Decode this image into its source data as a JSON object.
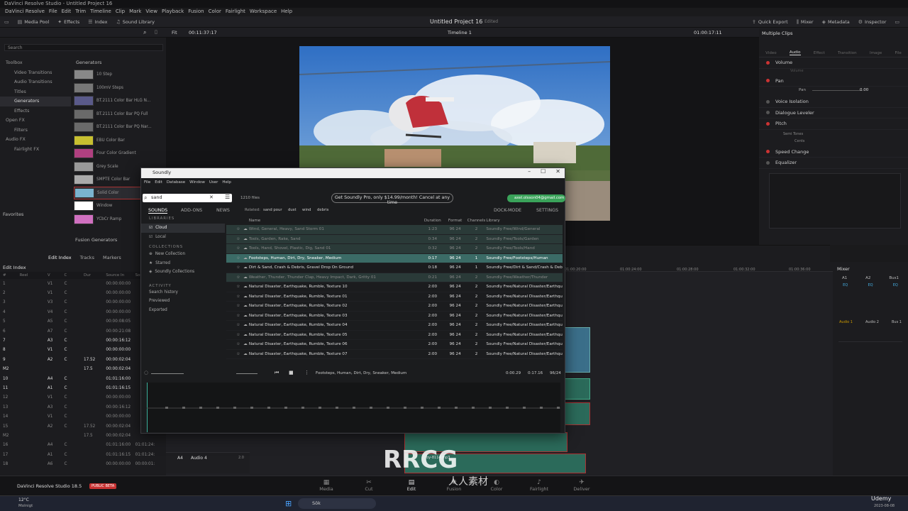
{
  "window_title": "DaVinci Resolve Studio - Untitled Project 16",
  "menu": [
    "DaVinci Resolve",
    "File",
    "Edit",
    "Trim",
    "Timeline",
    "Clip",
    "Mark",
    "View",
    "Playback",
    "Fusion",
    "Color",
    "Fairlight",
    "Workspace",
    "Help"
  ],
  "toolbar": {
    "left": [
      {
        "icon": "media-pool-icon",
        "label": "Media Pool"
      },
      {
        "icon": "effects-icon",
        "label": "Effects"
      },
      {
        "icon": "index-icon",
        "label": "Index"
      },
      {
        "icon": "sound-library-icon",
        "label": "Sound Library"
      }
    ],
    "project_title": "Untitled Project 16",
    "edited": "Edited",
    "right": [
      {
        "icon": "quick-export-icon",
        "label": "Quick Export"
      },
      {
        "icon": "mixer-icon",
        "label": "Mixer"
      },
      {
        "icon": "metadata-icon",
        "label": "Metadata"
      },
      {
        "icon": "inspector-icon",
        "label": "Inspector"
      }
    ]
  },
  "viewer": {
    "fit": "Fit",
    "timecode_left": "00:11:37:17",
    "timeline_name": "Timeline 1",
    "timecode_right": "01:00:17:11"
  },
  "effects": {
    "search_placeholder": "Search",
    "tree": [
      "Toolbox",
      "Video Transitions",
      "Audio Transitions",
      "Titles",
      "Generators",
      "Effects",
      "Open FX",
      "Filters",
      "Audio FX",
      "Fairlight FX"
    ],
    "favorites": "Favorites",
    "generators_header": "Generators",
    "generators": [
      {
        "label": "10 Step",
        "color": "#888"
      },
      {
        "label": "100mV Steps",
        "color": "#777"
      },
      {
        "label": "BT.2111 Color Bar HLG N...",
        "color": "#5a5a8a"
      },
      {
        "label": "BT.2111 Color Bar PQ Full",
        "color": "#6a6a6a"
      },
      {
        "label": "BT.2111 Color Bar PQ Nar...",
        "color": "#6a6a6a"
      },
      {
        "label": "EBU Color Bar",
        "color": "#c8c030"
      },
      {
        "label": "Four Color Gradient",
        "color": "#b04080"
      },
      {
        "label": "Grey Scale",
        "color": "#999"
      },
      {
        "label": "SMPTE Color Bar",
        "color": "#aaa"
      },
      {
        "label": "Solid Color",
        "color": "#7ab3cf"
      },
      {
        "label": "Window",
        "color": "#fff"
      },
      {
        "label": "YCbCr Ramp",
        "color": "#d070c0"
      }
    ],
    "fusion_generators": "Fusion Generators"
  },
  "inspector": {
    "header": "Multiple Clips",
    "tabs": [
      "Video",
      "Audio",
      "Effect",
      "Transition",
      "Image",
      "File"
    ],
    "active_tab": "Audio",
    "rows": [
      {
        "label": "Volume",
        "on": true
      },
      {
        "label": "Pan",
        "on": true
      },
      {
        "label": "Voice Isolation",
        "on": false
      },
      {
        "label": "Dialogue Leveler",
        "on": false
      },
      {
        "label": "Pitch",
        "on": true
      },
      {
        "label": "Speed Change",
        "on": true
      },
      {
        "label": "Equalizer",
        "on": false
      }
    ],
    "pan_label": "Pan",
    "pan_value": "0.00",
    "volume_sub": "Volume",
    "semitones": "Semi Tones",
    "cents": "Cents"
  },
  "edit_index": {
    "tabs": [
      "Edit Index",
      "Tracks",
      "Markers"
    ],
    "title": "Edit Index",
    "columns": [
      "#",
      "Reel",
      "V",
      "C",
      "Dur",
      "Source In",
      "Source Out"
    ],
    "rows": [
      [
        "1",
        "",
        "V1",
        "C",
        "",
        "00:00:00:00",
        ""
      ],
      [
        "2",
        "",
        "V1",
        "C",
        "",
        "00:00:00:00",
        ""
      ],
      [
        "3",
        "",
        "V3",
        "C",
        "",
        "00:00:00:00",
        ""
      ],
      [
        "4",
        "",
        "V4",
        "C",
        "",
        "00:00:00:00",
        ""
      ],
      [
        "5",
        "",
        "A5",
        "C",
        "",
        "00:00:08:05",
        ""
      ],
      [
        "6",
        "",
        "A7",
        "C",
        "",
        "00:00:21:08",
        ""
      ],
      [
        "7",
        "",
        "A3",
        "C",
        "",
        "00:00:16:12",
        ""
      ],
      [
        "8",
        "",
        "V1",
        "C",
        "",
        "00:00:00:00",
        ""
      ],
      [
        "9",
        "",
        "A2",
        "C",
        "17.52",
        "00:00:02:04",
        ""
      ],
      [
        "M2",
        "",
        "",
        "",
        "17.5",
        "00:00:02:04",
        ""
      ],
      [
        "10",
        "",
        "A4",
        "C",
        "",
        "01:01:16:00",
        ""
      ],
      [
        "11",
        "",
        "A1",
        "C",
        "",
        "01:01:16:15",
        ""
      ],
      [
        "12",
        "",
        "V1",
        "C",
        "",
        "00:00:00:00",
        ""
      ],
      [
        "13",
        "",
        "A3",
        "C",
        "",
        "00:00:16:12",
        ""
      ],
      [
        "14",
        "",
        "V1",
        "C",
        "",
        "00:00:00:00",
        ""
      ],
      [
        "15",
        "",
        "A2",
        "C",
        "17.52",
        "00:00:02:04",
        ""
      ],
      [
        "M2",
        "",
        "",
        "",
        "17.5",
        "00:00:02:04",
        ""
      ],
      [
        "16",
        "",
        "A4",
        "C",
        "",
        "01:01:16:00",
        "01:01:24:"
      ],
      [
        "17",
        "",
        "A1",
        "C",
        "",
        "01:01:16:15",
        "01:01:24:"
      ],
      [
        "18",
        "",
        "A6",
        "C",
        "",
        "00:00:00:00",
        "00:00:01:"
      ]
    ]
  },
  "timeline": {
    "ruler": [
      "01:00:20:00",
      "01:00:24:00",
      "01:00:28:00",
      "01:00:32:00",
      "01:00:36:00"
    ],
    "track_label": "Audio 4",
    "track_id": "A4",
    "track_level": "2.0",
    "clip_label": "by-8114.mp3"
  },
  "mixer": {
    "title": "Mixer",
    "channels": [
      "A1",
      "A2",
      "Bus1"
    ],
    "eq": "EQ",
    "names": [
      "Audio 1",
      "Audio 2",
      "Bus 1"
    ]
  },
  "pages": [
    "Media",
    "Cut",
    "Edit",
    "Fusion",
    "Color",
    "Fairlight",
    "Deliver"
  ],
  "app_brand": "DaVinci Resolve Studio 18.5",
  "beta_badge": "PUBLIC BETA",
  "taskbar": {
    "weather_temp": "12°C",
    "weather_desc": "Molnigt",
    "search": "Sök",
    "date": "2023-08-08"
  },
  "soundly": {
    "title": "Soundly",
    "menu": [
      "File",
      "Edit",
      "Database",
      "Window",
      "User",
      "Help"
    ],
    "window_controls": [
      "–",
      "☐",
      "✕"
    ],
    "search_value": "sand",
    "files_count": "1210 files",
    "promo": "Get Soundly Pro, only $14.99/month! Cancel at any time",
    "user": "axel.olsson04@gmail.com",
    "tabs": [
      "SOUNDS",
      "ADD-ONS",
      "NEWS"
    ],
    "related_label": "Related:",
    "related": [
      "sand pour",
      "dust",
      "wind",
      "debris"
    ],
    "right_tabs": [
      "DOCK-MODE",
      "SETTINGS"
    ],
    "libraries_header": "LIBRARIES",
    "libraries": [
      "Cloud",
      "Local"
    ],
    "collections_header": "COLLECTIONS",
    "collections": [
      "New Collection",
      "Starred",
      "Soundly Collections"
    ],
    "activity_header": "ACTIVITY",
    "activity": [
      "Search history",
      "Previewed",
      "Exported"
    ],
    "columns": [
      "Name",
      "Duration",
      "Format",
      "Channels",
      "Library"
    ],
    "rows": [
      {
        "name": "Wind, General, Heavy, Sand Storm 01",
        "dur": "1:23",
        "fmt": "96 24",
        "ch": "2",
        "lib": "Soundly Free/Wind/General",
        "state": "dim"
      },
      {
        "name": "Tools, Garden, Rake, Sand",
        "dur": "0:34",
        "fmt": "96 24",
        "ch": "2",
        "lib": "Soundly Free/Tools/Garden",
        "state": "dim"
      },
      {
        "name": "Tools, Hand, Shovel, Plastic, Dig, Sand 01",
        "dur": "0:32",
        "fmt": "96 24",
        "ch": "2",
        "lib": "Soundly Free/Tools/Hand",
        "state": "dim"
      },
      {
        "name": "Footsteps, Human, Dirt, Dry, Sneaker, Medium",
        "dur": "0:17",
        "fmt": "96 24",
        "ch": "1",
        "lib": "Soundly Free/Footsteps/Human",
        "state": "sel"
      },
      {
        "name": "Dirt & Sand, Crash & Debris, Gravel Drop On Ground",
        "dur": "0:18",
        "fmt": "96 24",
        "ch": "1",
        "lib": "Soundly Free/Dirt & Sand/Crash & Debris",
        "state": ""
      },
      {
        "name": "Weather, Thunder, Thunder Clap, Heavy Impact, Dark, Gritty 01",
        "dur": "0:21",
        "fmt": "96 24",
        "ch": "2",
        "lib": "Soundly Free/Weather/Thunder",
        "state": "dim"
      },
      {
        "name": "Natural Disaster, Earthquake, Rumble, Texture 10",
        "dur": "2:00",
        "fmt": "96 24",
        "ch": "2",
        "lib": "Soundly Free/Natural Disaster/Earthquake",
        "state": ""
      },
      {
        "name": "Natural Disaster, Earthquake, Rumble, Texture 01",
        "dur": "2:00",
        "fmt": "96 24",
        "ch": "2",
        "lib": "Soundly Free/Natural Disaster/Earthquake",
        "state": ""
      },
      {
        "name": "Natural Disaster, Earthquake, Rumble, Texture 02",
        "dur": "2:00",
        "fmt": "96 24",
        "ch": "2",
        "lib": "Soundly Free/Natural Disaster/Earthquake",
        "state": ""
      },
      {
        "name": "Natural Disaster, Earthquake, Rumble, Texture 03",
        "dur": "2:00",
        "fmt": "96 24",
        "ch": "2",
        "lib": "Soundly Free/Natural Disaster/Earthquake",
        "state": ""
      },
      {
        "name": "Natural Disaster, Earthquake, Rumble, Texture 04",
        "dur": "2:00",
        "fmt": "96 24",
        "ch": "2",
        "lib": "Soundly Free/Natural Disaster/Earthquake",
        "state": ""
      },
      {
        "name": "Natural Disaster, Earthquake, Rumble, Texture 05",
        "dur": "2:00",
        "fmt": "96 24",
        "ch": "2",
        "lib": "Soundly Free/Natural Disaster/Earthquake",
        "state": ""
      },
      {
        "name": "Natural Disaster, Earthquake, Rumble, Texture 06",
        "dur": "2:00",
        "fmt": "96 24",
        "ch": "2",
        "lib": "Soundly Free/Natural Disaster/Earthquake",
        "state": ""
      },
      {
        "name": "Natural Disaster, Earthquake, Rumble, Texture 07",
        "dur": "2:00",
        "fmt": "96 24",
        "ch": "2",
        "lib": "Soundly Free/Natural Disaster/Earthquake",
        "state": ""
      }
    ],
    "player": {
      "now_playing": "Footsteps, Human, Dirt, Dry, Sneaker, Medium",
      "position": "0:00.29",
      "length": "0:17.16",
      "format": "96/24"
    }
  },
  "watermark": {
    "brand": "RRCG",
    "sub": "人人素材",
    "corner": "Udemy"
  }
}
